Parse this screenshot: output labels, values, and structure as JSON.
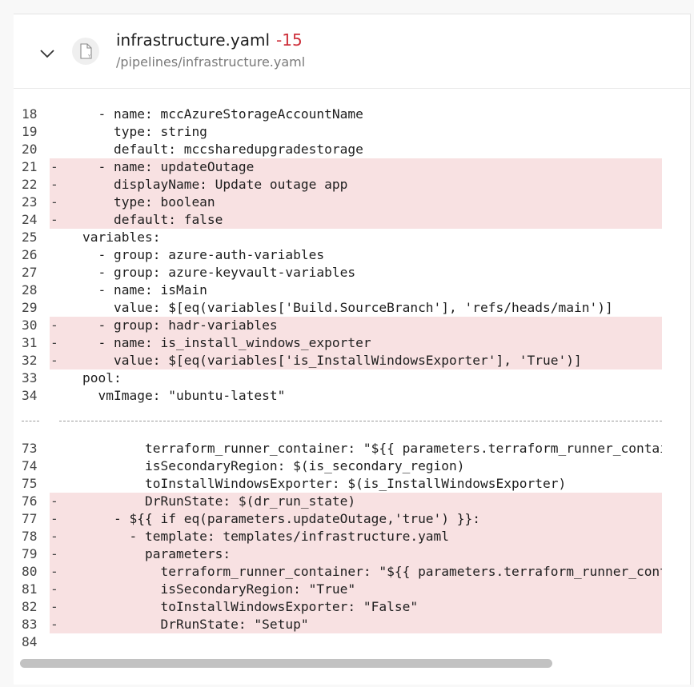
{
  "file": {
    "name": "infrastructure.yaml",
    "delta": "-15",
    "path": "/pipelines/infrastructure.yaml",
    "icon": "file-yaml-icon"
  },
  "colors": {
    "removed_bg": "#f8e1e2",
    "delta": "#cd2f3a"
  },
  "hunks": [
    {
      "lines": [
        {
          "num": "18",
          "mark": "",
          "text": "  - name: mccAzureStorageAccountName",
          "removed": false
        },
        {
          "num": "19",
          "mark": "",
          "text": "    type: string",
          "removed": false
        },
        {
          "num": "20",
          "mark": "",
          "text": "    default: mccsharedupgradestorage",
          "removed": false
        },
        {
          "num": "21",
          "mark": "-",
          "text": "  - name: updateOutage",
          "removed": true
        },
        {
          "num": "22",
          "mark": "-",
          "text": "    displayName: Update outage app",
          "removed": true
        },
        {
          "num": "23",
          "mark": "-",
          "text": "    type: boolean",
          "removed": true
        },
        {
          "num": "24",
          "mark": "-",
          "text": "    default: false",
          "removed": true
        },
        {
          "num": "25",
          "mark": "",
          "text": "variables:",
          "removed": false
        },
        {
          "num": "26",
          "mark": "",
          "text": "  - group: azure-auth-variables",
          "removed": false
        },
        {
          "num": "27",
          "mark": "",
          "text": "  - group: azure-keyvault-variables",
          "removed": false
        },
        {
          "num": "28",
          "mark": "",
          "text": "  - name: isMain",
          "removed": false
        },
        {
          "num": "29",
          "mark": "",
          "text": "    value: $[eq(variables['Build.SourceBranch'], 'refs/heads/main')]",
          "removed": false
        },
        {
          "num": "30",
          "mark": "-",
          "text": "  - group: hadr-variables",
          "removed": true
        },
        {
          "num": "31",
          "mark": "-",
          "text": "  - name: is_install_windows_exporter",
          "removed": true
        },
        {
          "num": "32",
          "mark": "-",
          "text": "    value: $[eq(variables['is_InstallWindowsExporter'], 'True')]",
          "removed": true
        },
        {
          "num": "33",
          "mark": "",
          "text": "pool:",
          "removed": false
        },
        {
          "num": "34",
          "mark": "",
          "text": "  vmImage: \"ubuntu-latest\"",
          "removed": false
        }
      ]
    },
    {
      "lines": [
        {
          "num": "73",
          "mark": "",
          "text": "        terraform_runner_container: \"${{ parameters.terraform_runner_container }}\"",
          "removed": false
        },
        {
          "num": "74",
          "mark": "",
          "text": "        isSecondaryRegion: $(is_secondary_region)",
          "removed": false
        },
        {
          "num": "75",
          "mark": "",
          "text": "        toInstallWindowsExporter: $(is_InstallWindowsExporter)",
          "removed": false
        },
        {
          "num": "76",
          "mark": "-",
          "text": "        DrRunState: $(dr_run_state)",
          "removed": true
        },
        {
          "num": "77",
          "mark": "-",
          "text": "    - ${{ if eq(parameters.updateOutage,'true') }}:",
          "removed": true
        },
        {
          "num": "78",
          "mark": "-",
          "text": "      - template: templates/infrastructure.yaml",
          "removed": true
        },
        {
          "num": "79",
          "mark": "-",
          "text": "        parameters:",
          "removed": true
        },
        {
          "num": "80",
          "mark": "-",
          "text": "          terraform_runner_container: \"${{ parameters.terraform_runner_container }}\"",
          "removed": true
        },
        {
          "num": "81",
          "mark": "-",
          "text": "          isSecondaryRegion: \"True\"",
          "removed": true
        },
        {
          "num": "82",
          "mark": "-",
          "text": "          toInstallWindowsExporter: \"False\"",
          "removed": true
        },
        {
          "num": "83",
          "mark": "-",
          "text": "          DrRunState: \"Setup\"",
          "removed": true
        },
        {
          "num": "84",
          "mark": "",
          "text": "",
          "removed": false
        }
      ]
    }
  ]
}
